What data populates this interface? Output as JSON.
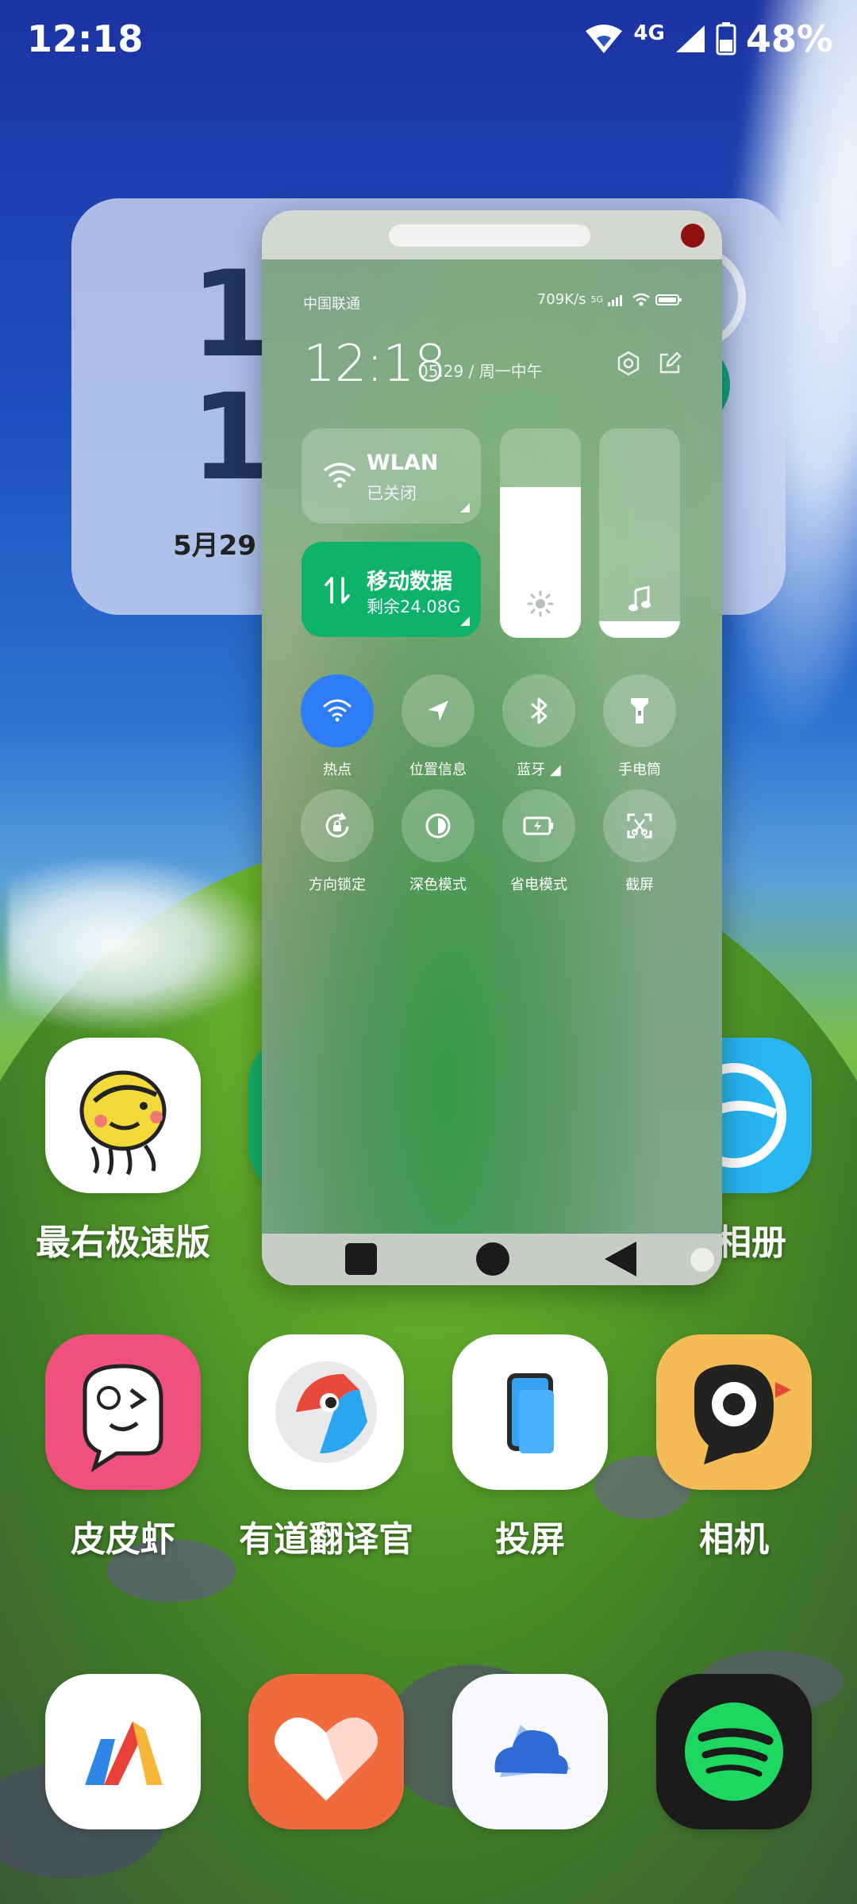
{
  "status_bar": {
    "time": "12:18",
    "network": "4G",
    "battery": "48%"
  },
  "clock_widget": {
    "hour": "12",
    "minute": "18",
    "date": "5月29"
  },
  "floating_window": {
    "status": {
      "carrier": "中国联通",
      "speed": "709K/s",
      "net_type": "5G"
    },
    "time": "12:18",
    "date": "05.29 / 周一中午",
    "wlan": {
      "title": "WLAN",
      "subtitle": "已关闭"
    },
    "mobile_data": {
      "title": "移动数据",
      "subtitle": "剩余24.08G"
    },
    "brightness_level": 0.72,
    "volume_level": 0.08,
    "toggles": [
      {
        "label": "热点",
        "icon": "hotspot-icon",
        "active": true
      },
      {
        "label": "位置信息",
        "icon": "location-icon",
        "active": false
      },
      {
        "label": "蓝牙",
        "icon": "bluetooth-icon",
        "active": false
      },
      {
        "label": "手电筒",
        "icon": "flashlight-icon",
        "active": false
      },
      {
        "label": "方向锁定",
        "icon": "rotation-lock-icon",
        "active": false
      },
      {
        "label": "深色模式",
        "icon": "dark-mode-icon",
        "active": false
      },
      {
        "label": "省电模式",
        "icon": "battery-saver-icon",
        "active": false
      },
      {
        "label": "截屏",
        "icon": "screenshot-icon",
        "active": false
      }
    ]
  },
  "apps": {
    "row1": [
      "最右极速版",
      "相册"
    ],
    "row1_partial_label": "二相册",
    "row2": [
      "皮皮虾",
      "有道翻译官",
      "投屏",
      "相机"
    ],
    "dock": [
      "Vector",
      "Health",
      "Cloud",
      "Spotify"
    ]
  },
  "colors": {
    "active_blue": "#2f7df6",
    "data_green": "#0eb26b",
    "close_red": "#8f1010"
  }
}
